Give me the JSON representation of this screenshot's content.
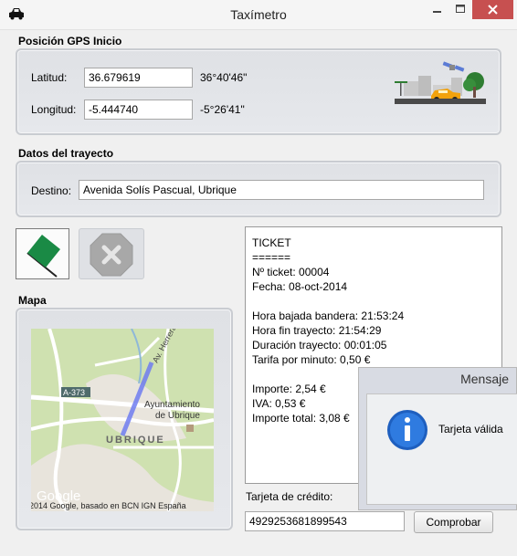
{
  "window": {
    "title": "Taxímetro"
  },
  "gps": {
    "section_title": "Posición GPS Inicio",
    "lat_label": "Latitud:",
    "lat_value": "36.679619",
    "lat_dms": "36°40'46\"",
    "lon_label": "Longitud:",
    "lon_value": "-5.444740",
    "lon_dms": "-5°26'41\""
  },
  "trip": {
    "section_title": "Datos del trayecto",
    "dest_label": "Destino:",
    "dest_value": "Avenida Solís Pascual, Ubrique"
  },
  "map": {
    "section_title": "Mapa",
    "labels": {
      "road": "A-373",
      "street": "Av. Herrera Oria",
      "townhall1": "Ayuntamiento",
      "townhall2": "de Ubrique",
      "town": "UBRIQUE",
      "logo": "Google",
      "copyright": "2014 Google, basado en BCN IGN España"
    }
  },
  "ticket": {
    "lines": [
      "TICKET",
      "======",
      "Nº ticket: 00004",
      "Fecha: 08-oct-2014",
      "",
      "Hora bajada bandera: 21:53:24",
      "Hora fin trayecto: 21:54:29",
      "Duración trayecto: 00:01:05",
      "Tarifa por minuto: 0,50 €",
      "",
      "Importe: 2,54 €",
      "IVA: 0,53 €",
      "Importe total: 3,08 €"
    ]
  },
  "payment": {
    "card_label": "Tarjeta de crédito:",
    "card_value": "4929253681899543",
    "check_button": "Comprobar"
  },
  "dialog": {
    "title": "Mensaje",
    "message": "Tarjeta válida"
  },
  "colors": {
    "accent_green": "#1a8a45",
    "close_red": "#c75050",
    "route_blue": "#6f7df0"
  }
}
